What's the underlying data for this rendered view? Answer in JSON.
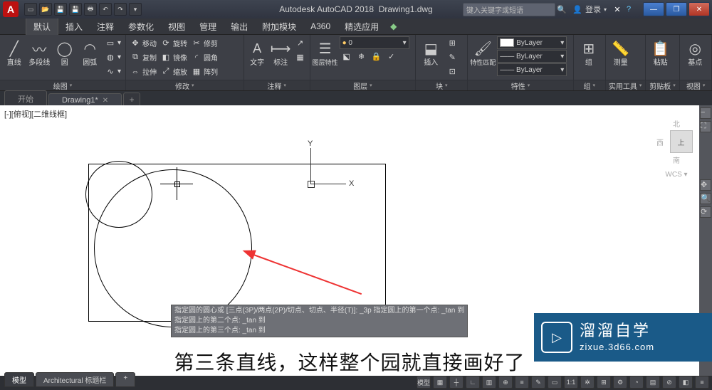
{
  "title_bar": {
    "app_name": "Autodesk AutoCAD 2018",
    "file_name": "Drawing1.dwg",
    "search_placeholder": "键入关键字或短语",
    "login": "登录",
    "app_icon_letter": "A"
  },
  "qat_icons": [
    "new",
    "open",
    "save",
    "undo",
    "redo",
    "print",
    "plot",
    "arrow",
    "share"
  ],
  "menu_tabs": {
    "active": "默认",
    "items": [
      "默认",
      "插入",
      "注释",
      "参数化",
      "视图",
      "管理",
      "输出",
      "附加模块",
      "A360",
      "精选应用"
    ]
  },
  "ribbon": {
    "draw": {
      "title": "绘图",
      "line": "直线",
      "pline": "多段线",
      "circle": "圆",
      "arc": "圆弧"
    },
    "modify": {
      "title": "修改",
      "move": "移动",
      "rotate": "旋转",
      "trim": "修剪",
      "copy": "复制",
      "mirror": "镜像",
      "fillet": "圆角",
      "stretch": "拉伸",
      "scale": "缩放",
      "array": "阵列"
    },
    "annot": {
      "title": "注释",
      "text": "文字",
      "dim": "标注",
      "table": "表格"
    },
    "layer": {
      "title": "图层",
      "props": "图层特性"
    },
    "block": {
      "title": "块",
      "insert": "插入",
      "edit": "编辑",
      "create": "创建"
    },
    "props": {
      "title": "特性",
      "match": "特性匹配",
      "bylayer": "ByLayer"
    },
    "group": {
      "title": "组",
      "group": "组"
    },
    "util": {
      "title": "实用工具",
      "measure": "测量"
    },
    "clip": {
      "title": "剪贴板",
      "paste": "粘贴"
    },
    "view": {
      "title": "视图",
      "base": "基点"
    }
  },
  "file_tabs": {
    "start": "开始",
    "active": "Drawing1*"
  },
  "viewport_label": "[-][俯视][二维线框]",
  "ucs": {
    "x": "X",
    "y": "Y"
  },
  "navcube": {
    "north": "北",
    "west": "西",
    "top": "上",
    "south": "南",
    "wcs": "WCS ▾"
  },
  "cmd": {
    "l1": "指定圆的圆心或 [三点(3P)/两点(2P)/切点、切点、半径(T)]: _3p 指定圆上的第一个点: _tan 到",
    "l2": "指定圆上的第二个点: _tan 到",
    "l3": "指定圆上的第三个点: _tan 到"
  },
  "subtitle": "第三条直线，这样整个园就直接画好了",
  "watermark": {
    "logo": "▷",
    "name": "溜溜自学",
    "url": "zixue.3d66.com"
  },
  "model_tabs": {
    "model": "模型",
    "arch": "Architectural 标题栏"
  },
  "status_right": [
    "模型",
    "▦",
    "┼",
    "∟",
    "▥",
    "⊕",
    "≡",
    "✎",
    "▭",
    "1:1",
    "✲",
    "⊞",
    "⚙",
    "◔",
    "▤",
    "⊘",
    "◧",
    "≡"
  ]
}
